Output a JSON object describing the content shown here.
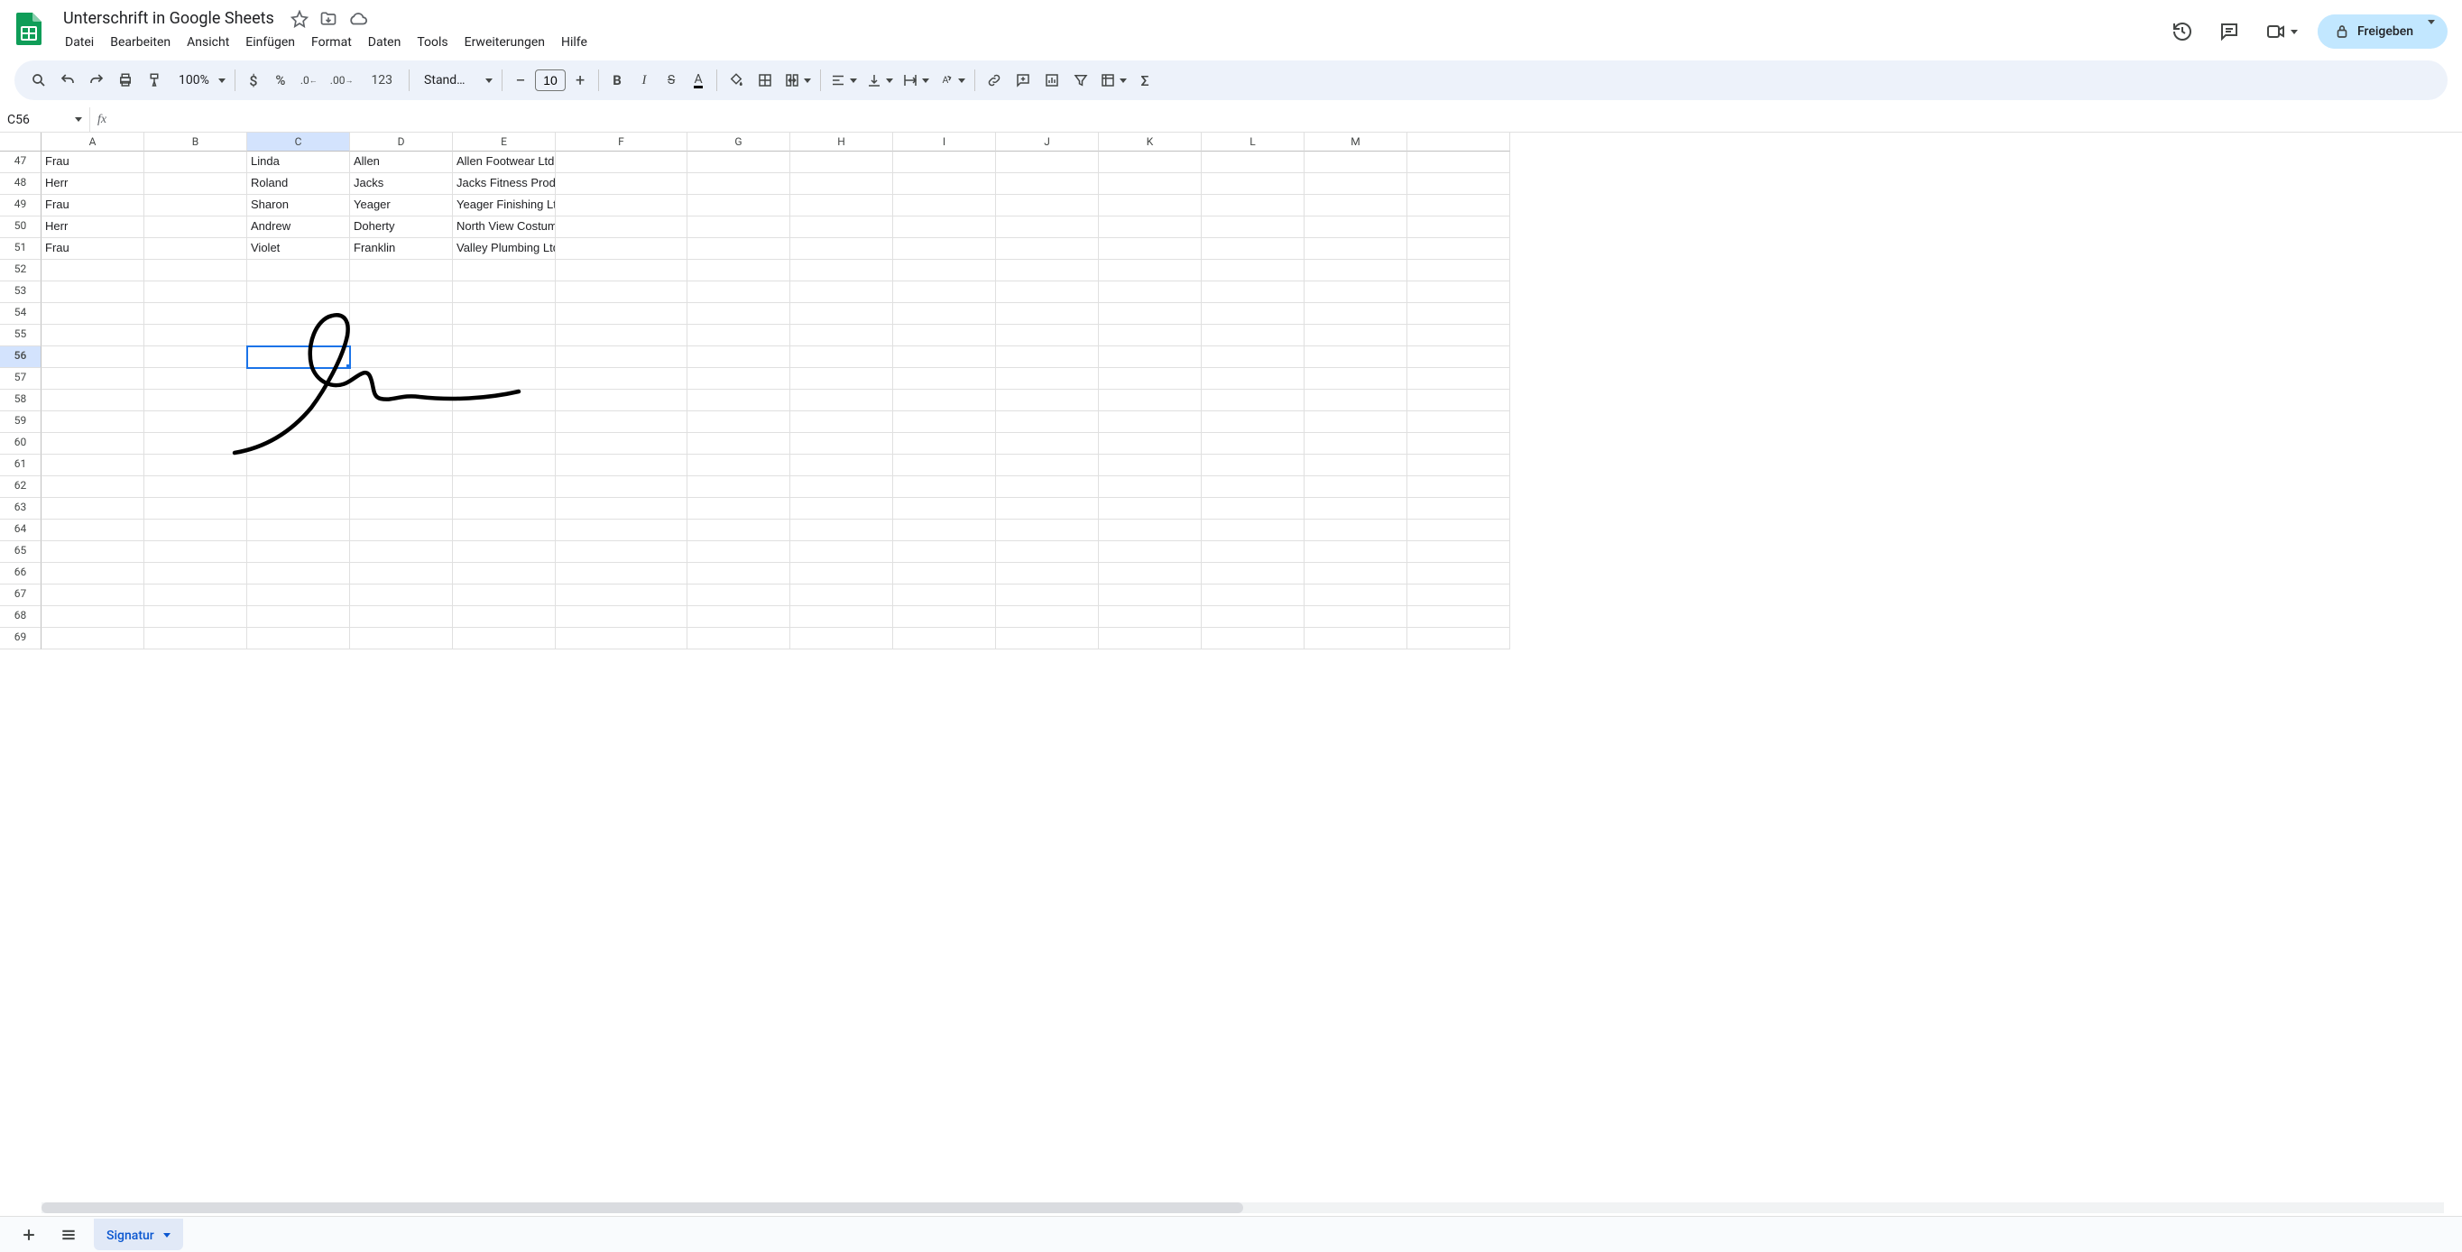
{
  "doc": {
    "title": "Unterschrift in Google Sheets"
  },
  "menu": [
    "Datei",
    "Bearbeiten",
    "Ansicht",
    "Einfügen",
    "Format",
    "Daten",
    "Tools",
    "Erweiterungen",
    "Hilfe"
  ],
  "share": {
    "label": "Freigeben"
  },
  "toolbar": {
    "zoom": "100%",
    "number_btn": "123",
    "font": "Stand…",
    "font_size": "10"
  },
  "namebox": "C56",
  "formula": "",
  "columns": [
    "A",
    "B",
    "C",
    "D",
    "E",
    "F",
    "G",
    "H",
    "I",
    "J",
    "K",
    "L",
    "M"
  ],
  "selected_col_idx": 2,
  "row_start": 47,
  "row_end": 69,
  "selected_row": 56,
  "selected_cell": {
    "row": 56,
    "col": "C"
  },
  "rows": {
    "47": {
      "A": "Frau",
      "C": "Linda",
      "D": "Allen",
      "E": "Allen Footwear Ltd"
    },
    "48": {
      "A": "Herr",
      "C": "Roland",
      "D": "Jacks",
      "E": "Jacks Fitness Products Ltd"
    },
    "49": {
      "A": "Frau",
      "C": "Sharon",
      "D": "Yeager",
      "E": "Yeager Finishing Ltd"
    },
    "50": {
      "A": "Herr",
      "C": "Andrew",
      "D": "Doherty",
      "E": "North View Costume Hire Ltd"
    },
    "51": {
      "A": "Frau",
      "C": "Violet",
      "D": "Franklin",
      "E": "Valley Plumbing Ltd"
    }
  },
  "sheet_tab": "Signatur"
}
